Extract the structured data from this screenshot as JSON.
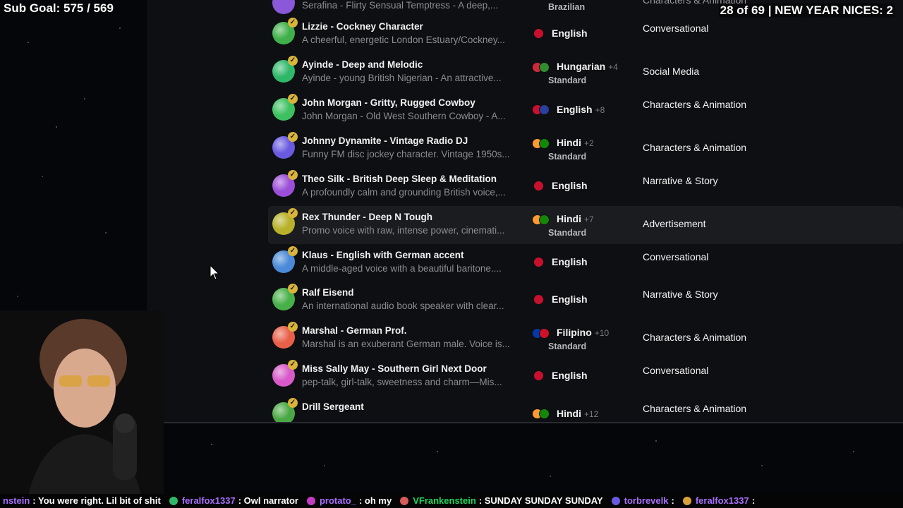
{
  "stream_overlay": {
    "sub_goal": "Sub Goal: 575 / 569",
    "counter": "28 of 69 | NEW YEAR NICES: 2"
  },
  "voice_list": {
    "top_partial": {
      "name": "Serafina - Flirty Sensual Temptress - A deep,...",
      "lang": "Brazilian",
      "cat": "Characters & Animation"
    },
    "rows": [
      {
        "name": "Lizzie - Cockney Character",
        "desc": "A cheerful, energetic London Estuary/Cockney...",
        "lang": "English",
        "plus": "",
        "std": "",
        "cat": "Conversational",
        "avatar": "#3fb04a"
      },
      {
        "name": "Ayinde - Deep and Melodic",
        "desc": "Ayinde - young British Nigerian - An attractive...",
        "lang": "Hungarian",
        "plus": "+4",
        "std": "Standard",
        "cat": "Social Media",
        "avatar": "#2fb86a"
      },
      {
        "name": "John Morgan - Gritty, Rugged Cowboy",
        "desc": "John Morgan - Old West Southern Cowboy - A...",
        "lang": "English",
        "plus": "+8",
        "std": "",
        "cat": "Characters & Animation",
        "avatar": "#3cc060"
      },
      {
        "name": "Johnny Dynamite - Vintage Radio DJ",
        "desc": "Funny FM disc jockey character. Vintage 1950s...",
        "lang": "Hindi",
        "plus": "+2",
        "std": "Standard",
        "cat": "Characters & Animation",
        "avatar": "#6a5ae0"
      },
      {
        "name": "Theo Silk - British Deep Sleep & Meditation",
        "desc": "A profoundly calm and grounding British voice,...",
        "lang": "English",
        "plus": "",
        "std": "",
        "cat": "Narrative & Story",
        "avatar": "#9b4fd8"
      },
      {
        "name": "Rex Thunder - Deep N Tough",
        "desc": "Promo voice with raw, intense power, cinemati...",
        "lang": "Hindi",
        "plus": "+7",
        "std": "Standard",
        "cat": "Advertisement",
        "avatar": "#b7b22a"
      },
      {
        "name": "Klaus - English with German accent",
        "desc": "A middle-aged voice with a beautiful baritone....",
        "lang": "English",
        "plus": "",
        "std": "",
        "cat": "Conversational",
        "avatar": "#4a8ad8"
      },
      {
        "name": "Ralf Eisend",
        "desc": "An international audio book speaker with clear...",
        "lang": "English",
        "plus": "",
        "std": "",
        "cat": "Narrative & Story",
        "avatar": "#48b048"
      },
      {
        "name": "Marshal - German Prof.",
        "desc": "Marshal is an exuberant German male. Voice is...",
        "lang": "Filipino",
        "plus": "+10",
        "std": "Standard",
        "cat": "Characters & Animation",
        "avatar": "#e8604a"
      },
      {
        "name": "Miss Sally May - Southern Girl Next Door",
        "desc": "pep-talk, girl-talk, sweetness and charm—Mis...",
        "lang": "English",
        "plus": "",
        "std": "",
        "cat": "Conversational",
        "avatar": "#d85ac8"
      },
      {
        "name": "Drill Sergeant",
        "desc": "",
        "lang": "Hindi",
        "plus": "+12",
        "std": "",
        "cat": "Characters & Animation",
        "avatar": "#4aa844"
      }
    ]
  },
  "chat": [
    {
      "user": "nstein",
      "msg": ": You were right. Lil bit of shit"
    },
    {
      "user": "feralfox1337",
      "msg": ": Owl narrator"
    },
    {
      "user": "protato_",
      "msg": ": oh my"
    },
    {
      "user": "VFrankenstein",
      "msg": ": SUNDAY SUNDAY SUNDAY"
    },
    {
      "user": "torbrevelk",
      "msg": ":"
    },
    {
      "user": "feralfox1337",
      "msg": ":"
    }
  ]
}
